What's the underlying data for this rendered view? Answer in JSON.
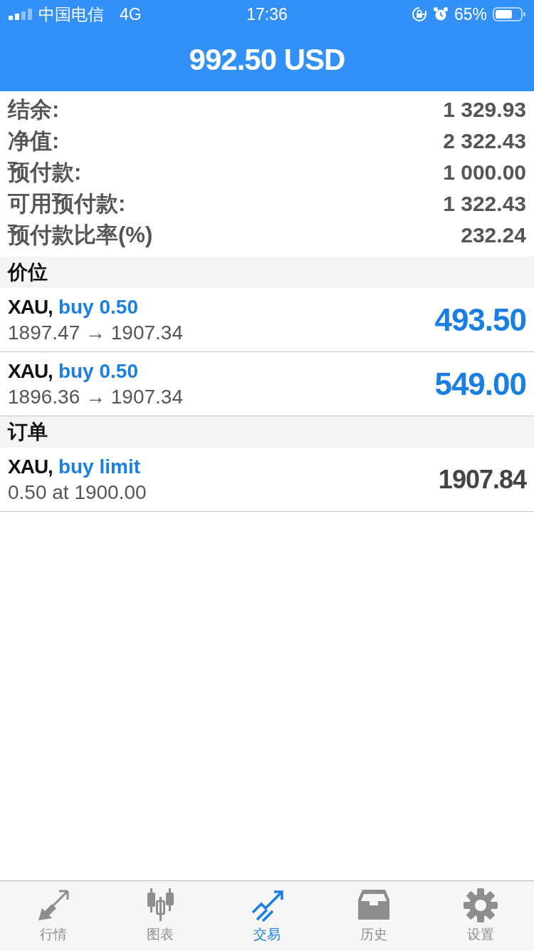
{
  "status_bar": {
    "carrier": "中国电信",
    "network": "4G",
    "time": "17:36",
    "battery": "65%"
  },
  "header": {
    "title": "992.50 USD"
  },
  "summary": [
    {
      "label": "结余:",
      "value": "1 329.93"
    },
    {
      "label": "净值:",
      "value": "2 322.43"
    },
    {
      "label": "预付款:",
      "value": "1 000.00"
    },
    {
      "label": "可用预付款:",
      "value": "1 322.43"
    },
    {
      "label": "预付款比率(%)",
      "value": "232.24"
    }
  ],
  "sections": [
    {
      "title": "价位",
      "kind": "positions",
      "items": [
        {
          "symbol": "XAU,",
          "action": "buy 0.50",
          "detail": "1897.47 → 1907.34",
          "amount": "493.50"
        },
        {
          "symbol": "XAU,",
          "action": "buy 0.50",
          "detail": "1896.36 → 1907.34",
          "amount": "549.00"
        }
      ]
    },
    {
      "title": "订单",
      "kind": "orders",
      "items": [
        {
          "symbol": "XAU,",
          "action": "buy limit",
          "detail": "0.50 at 1900.00",
          "amount": "1907.84"
        }
      ]
    }
  ],
  "tab_bar": [
    {
      "label": "行情",
      "kind": "quotes",
      "selected": false
    },
    {
      "label": "图表",
      "kind": "chart",
      "selected": false
    },
    {
      "label": "交易",
      "kind": "trade",
      "selected": true
    },
    {
      "label": "历史",
      "kind": "history",
      "selected": false
    },
    {
      "label": "设置",
      "kind": "settings",
      "selected": false
    }
  ]
}
